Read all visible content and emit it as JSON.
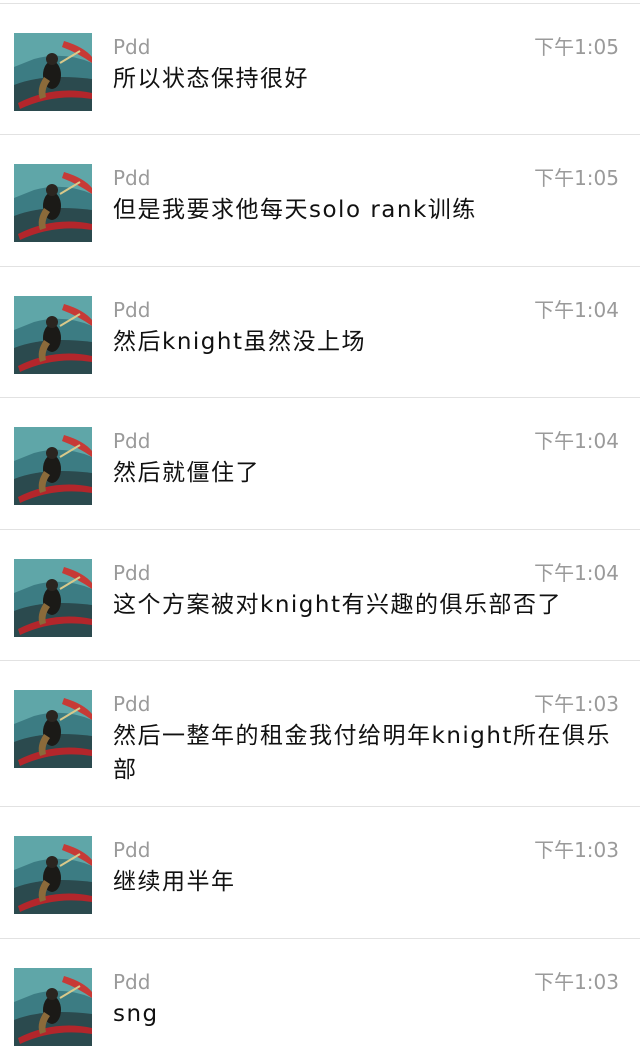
{
  "chat": {
    "messages": [
      {
        "sender": "Pdd",
        "time": "下午1:05",
        "text": "所以状态保持很好",
        "avatar": "hero-avatar"
      },
      {
        "sender": "Pdd",
        "time": "下午1:05",
        "text": "但是我要求他每天solo rank训练",
        "avatar": "hero-avatar"
      },
      {
        "sender": "Pdd",
        "time": "下午1:04",
        "text": "然后knight虽然没上场",
        "avatar": "hero-avatar"
      },
      {
        "sender": "Pdd",
        "time": "下午1:04",
        "text": "然后就僵住了",
        "avatar": "hero-avatar"
      },
      {
        "sender": "Pdd",
        "time": "下午1:04",
        "text": "这个方案被对knight有兴趣的俱乐部否了",
        "avatar": "hero-avatar"
      },
      {
        "sender": "Pdd",
        "time": "下午1:03",
        "text": "然后一整年的租金我付给明年knight所在俱乐部",
        "avatar": "hero-avatar"
      },
      {
        "sender": "Pdd",
        "time": "下午1:03",
        "text": "继续用半年",
        "avatar": "hero-avatar"
      },
      {
        "sender": "Pdd",
        "time": "下午1:03",
        "text": "sng",
        "avatar": "hero-avatar"
      }
    ]
  }
}
